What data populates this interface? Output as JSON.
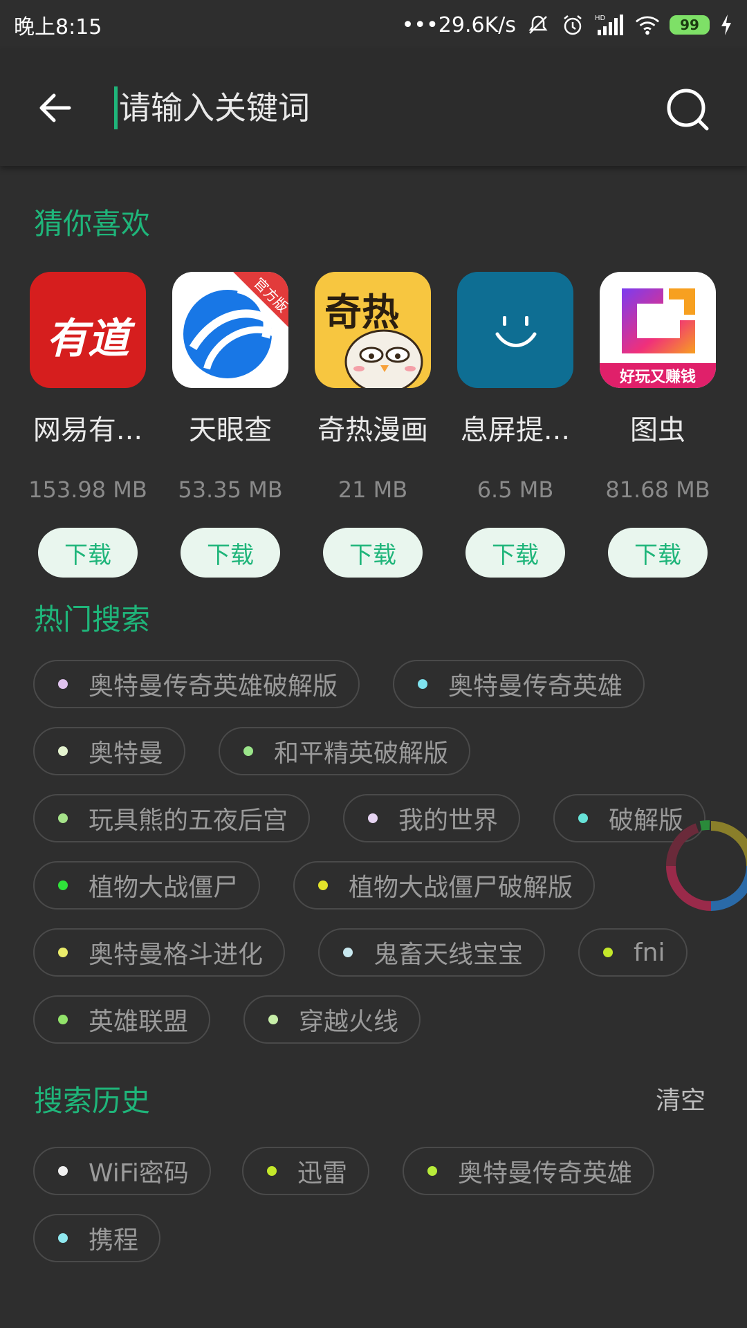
{
  "status": {
    "time": "晚上8:15",
    "speed": "•••29.6K/s",
    "hd": "HD",
    "battery": "99"
  },
  "search": {
    "placeholder": "请输入关键词"
  },
  "recommend": {
    "title": "猜你喜欢",
    "download_label": "下载",
    "apps": [
      {
        "name": "网易有...",
        "size": "153.98 MB",
        "icon": "youdao-icon",
        "icon_text": "有道"
      },
      {
        "name": "天眼查",
        "size": "53.35 MB",
        "icon": "tianyancha-icon",
        "badge": "官方版"
      },
      {
        "name": "奇热漫画",
        "size": "21 MB",
        "icon": "qire-manhua-icon",
        "icon_text": "奇热"
      },
      {
        "name": "息屏提...",
        "size": "6.5 MB",
        "icon": "smiley-icon"
      },
      {
        "name": "图虫",
        "size": "81.68 MB",
        "icon": "tuchong-icon",
        "icon_text": "好玩又赚钱"
      }
    ]
  },
  "hot": {
    "title": "热门搜索",
    "tags": [
      {
        "label": "奥特曼传奇英雄破解版",
        "color": "#e0c3ee"
      },
      {
        "label": "奥特曼传奇英雄",
        "color": "#7fe3ef"
      },
      {
        "label": "奥特曼",
        "color": "#e4f3cf"
      },
      {
        "label": "和平精英破解版",
        "color": "#9be58a"
      },
      {
        "label": "玩具熊的五夜后宫",
        "color": "#a6e38a"
      },
      {
        "label": "我的世界",
        "color": "#e6d4f2"
      },
      {
        "label": "破解版",
        "color": "#67e3d8"
      },
      {
        "label": "植物大战僵尸",
        "color": "#2fe33a"
      },
      {
        "label": "植物大战僵尸破解版",
        "color": "#e3e32a"
      },
      {
        "label": "奥特曼格斗进化",
        "color": "#eaec6a"
      },
      {
        "label": "鬼畜天线宝宝",
        "color": "#c8e8ef"
      },
      {
        "label": "fni",
        "color": "#c4e82a"
      },
      {
        "label": "英雄联盟",
        "color": "#92e36a"
      },
      {
        "label": "穿越火线",
        "color": "#c7eea8"
      }
    ]
  },
  "history": {
    "title": "搜索历史",
    "clear_label": "清空",
    "tags": [
      {
        "label": "WiFi密码",
        "color": "#f0f0f0"
      },
      {
        "label": "迅雷",
        "color": "#c4e82a"
      },
      {
        "label": "奥特曼传奇英雄",
        "color": "#b8ec3a"
      },
      {
        "label": "携程",
        "color": "#8fe8ef"
      }
    ]
  }
}
